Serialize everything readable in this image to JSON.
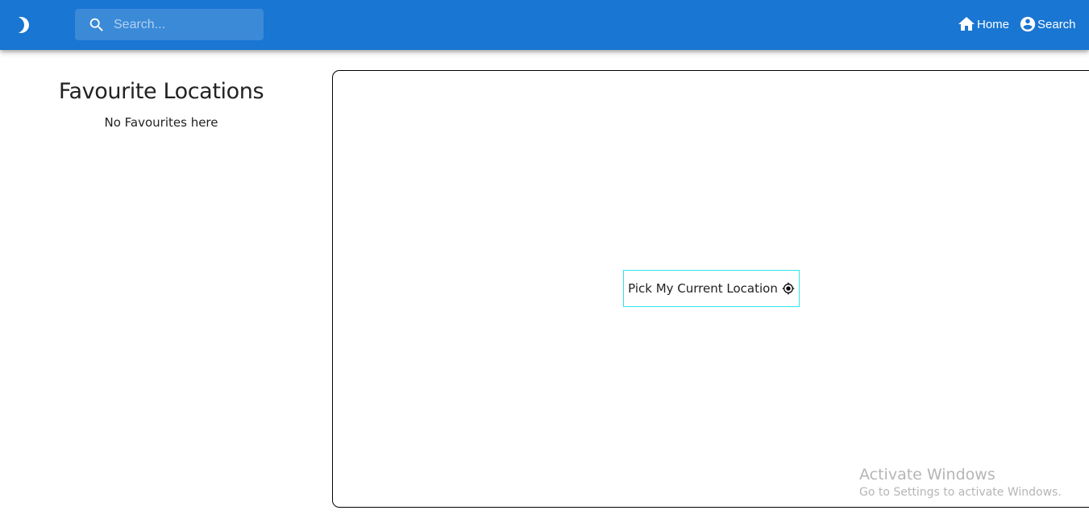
{
  "header": {
    "theme_toggle_icon": "moon-icon",
    "search": {
      "placeholder": "Search...",
      "value": ""
    },
    "nav": [
      {
        "label": "Home",
        "icon": "home-icon"
      },
      {
        "label": "Search",
        "icon": "account-circle-icon"
      }
    ],
    "colors": {
      "appbar": "#1976d2",
      "text": "#ffffff"
    }
  },
  "favourites": {
    "title": "Favourite Locations",
    "empty_message": "No Favourites here"
  },
  "map": {
    "locate_button_label": "Pick My Current Location",
    "locate_icon": "my-location-icon",
    "button_border_color": "#2ee6e6"
  },
  "watermark": {
    "title": "Activate Windows",
    "subtitle": "Go to Settings to activate Windows."
  }
}
